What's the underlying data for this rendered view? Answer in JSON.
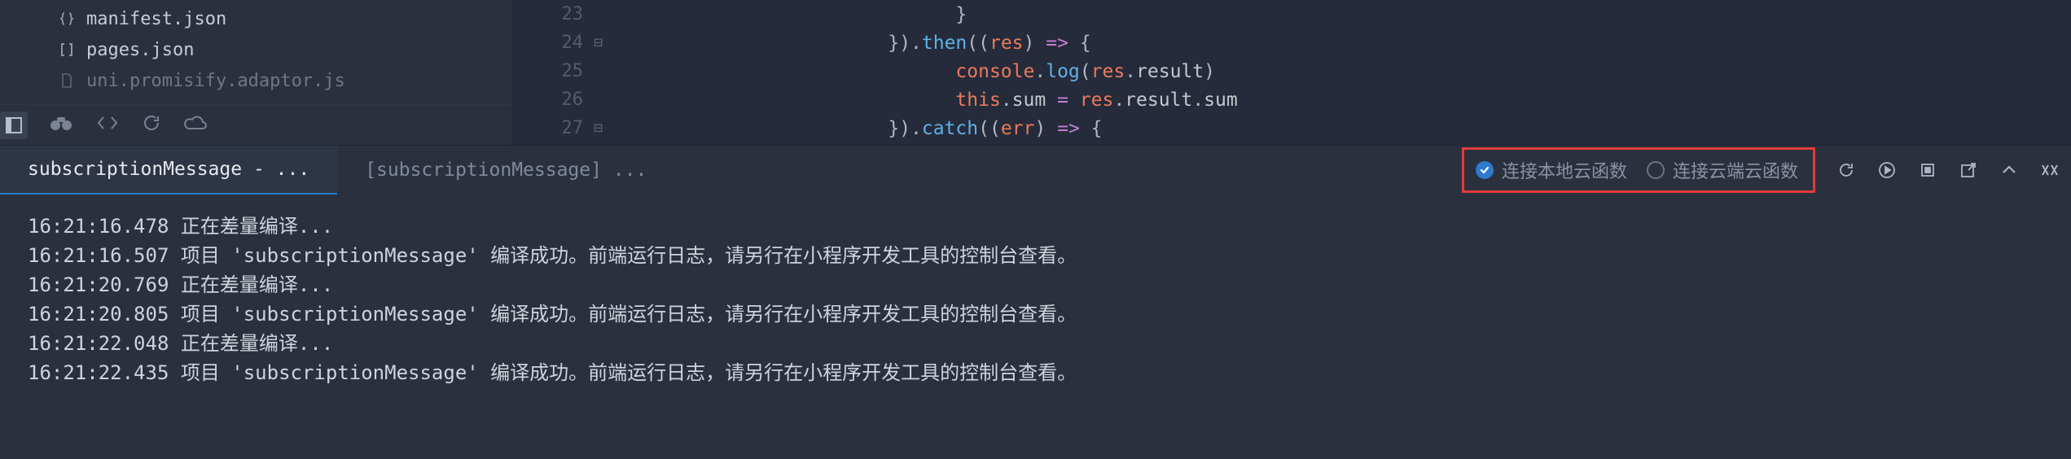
{
  "sidebar": {
    "files": [
      {
        "icon": "braces-icon",
        "label": "manifest.json"
      },
      {
        "icon": "brackets-icon",
        "label": "pages.json"
      },
      {
        "icon": "file-icon",
        "label": "uni.promisify.adaptor.js",
        "faded": true
      }
    ]
  },
  "editor": {
    "lines": [
      {
        "num": "23",
        "fold": "",
        "indent": "                              ",
        "tokens": [
          {
            "t": "}",
            "c": "c0"
          }
        ]
      },
      {
        "num": "24",
        "fold": "⊟",
        "indent": "                        ",
        "tokens": [
          {
            "t": "}).",
            "c": "c0"
          },
          {
            "t": "then",
            "c": "c1"
          },
          {
            "t": "((",
            "c": "c0"
          },
          {
            "t": "res",
            "c": "c3"
          },
          {
            "t": ") ",
            "c": "c0"
          },
          {
            "t": "=>",
            "c": "c4"
          },
          {
            "t": " {",
            "c": "c0"
          }
        ]
      },
      {
        "num": "25",
        "fold": "",
        "indent": "                              ",
        "tokens": [
          {
            "t": "console",
            "c": "c3"
          },
          {
            "t": ".",
            "c": "c0"
          },
          {
            "t": "log",
            "c": "c1"
          },
          {
            "t": "(",
            "c": "c0"
          },
          {
            "t": "res",
            "c": "c3"
          },
          {
            "t": ".",
            "c": "c0"
          },
          {
            "t": "result",
            "c": "c2"
          },
          {
            "t": ")",
            "c": "c0"
          }
        ]
      },
      {
        "num": "26",
        "fold": "",
        "indent": "                              ",
        "tokens": [
          {
            "t": "this",
            "c": "c3"
          },
          {
            "t": ".",
            "c": "c0"
          },
          {
            "t": "sum",
            "c": "c2"
          },
          {
            "t": " = ",
            "c": "c4"
          },
          {
            "t": "res",
            "c": "c3"
          },
          {
            "t": ".",
            "c": "c0"
          },
          {
            "t": "result",
            "c": "c2"
          },
          {
            "t": ".",
            "c": "c0"
          },
          {
            "t": "sum",
            "c": "c2"
          }
        ]
      },
      {
        "num": "27",
        "fold": "⊟",
        "indent": "                        ",
        "tokens": [
          {
            "t": "}).",
            "c": "c0"
          },
          {
            "t": "catch",
            "c": "c1"
          },
          {
            "t": "((",
            "c": "c0"
          },
          {
            "t": "err",
            "c": "c3"
          },
          {
            "t": ") ",
            "c": "c0"
          },
          {
            "t": "=>",
            "c": "c4"
          },
          {
            "t": " {",
            "c": "c0"
          }
        ]
      }
    ]
  },
  "panel": {
    "tabs": [
      {
        "label": "subscriptionMessage - ...",
        "active": true
      },
      {
        "label": "[subscriptionMessage] ...",
        "active": false
      }
    ],
    "radios": {
      "local": "连接本地云函数",
      "cloud": "连接云端云函数"
    },
    "log": [
      {
        "ts": "16:21:16.478",
        "msg": "正在差量编译..."
      },
      {
        "ts": "16:21:16.507",
        "msg": "项目 'subscriptionMessage' 编译成功。前端运行日志，请另行在小程序开发工具的控制台查看。"
      },
      {
        "ts": "16:21:20.769",
        "msg": "正在差量编译..."
      },
      {
        "ts": "16:21:20.805",
        "msg": "项目 'subscriptionMessage' 编译成功。前端运行日志，请另行在小程序开发工具的控制台查看。"
      },
      {
        "ts": "16:21:22.048",
        "msg": "正在差量编译..."
      },
      {
        "ts": "16:21:22.435",
        "msg": "项目 'subscriptionMessage' 编译成功。前端运行日志，请另行在小程序开发工具的控制台查看。"
      }
    ]
  }
}
